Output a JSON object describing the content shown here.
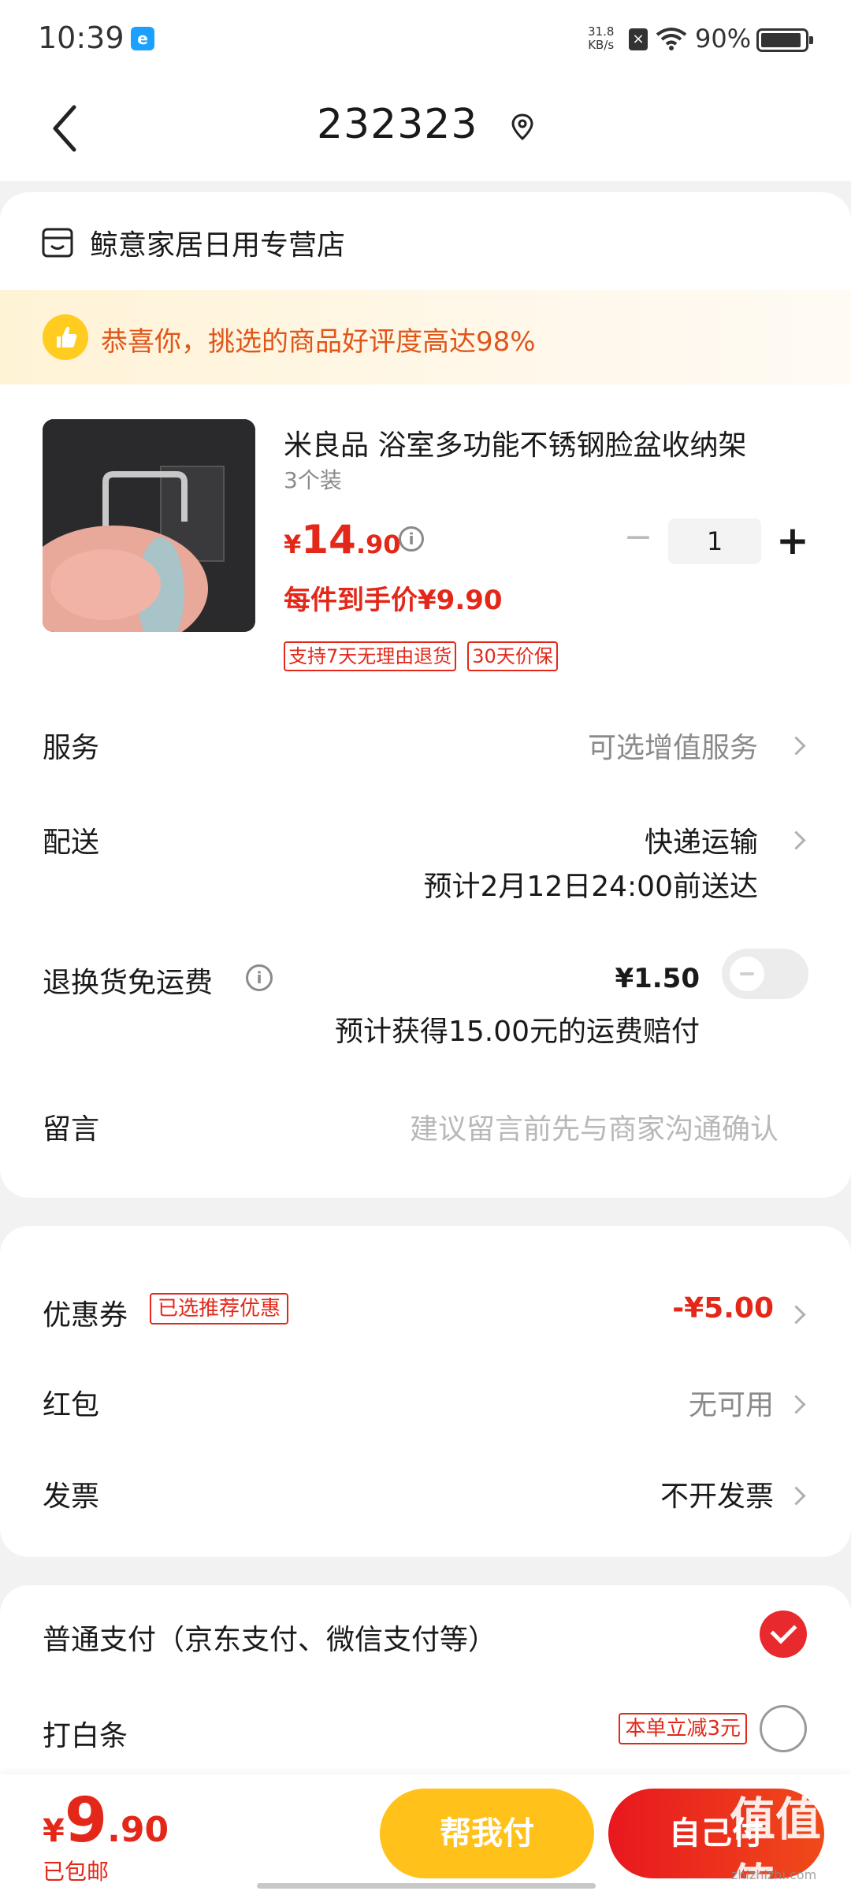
{
  "status_bar": {
    "time": "10:39",
    "net_speed": "31.8",
    "net_unit": "KB/s",
    "battery": "90%",
    "battery_level": 0.9
  },
  "header": {
    "title": "232323"
  },
  "store": {
    "name": "鲸意家居日用专营店"
  },
  "banner": {
    "text": "恭喜你，挑选的商品好评度高达98%"
  },
  "product": {
    "name": "米良品 浴室多功能不锈钢脸盆收纳架",
    "spec": "3个装",
    "price_currency": "¥",
    "price_int": "14",
    "price_dec": ".90",
    "quantity": "1",
    "unit_price": "每件到手价¥9.90",
    "tags": [
      "支持7天无理由退货",
      "30天价保"
    ]
  },
  "rows": {
    "service_label": "服务",
    "service_value": "可选增值服务",
    "delivery_label": "配送",
    "delivery_value": "快递运输",
    "delivery_eta": "预计2月12日24:00前送达",
    "return_label": "退换货免运费",
    "return_price": "¥1.50",
    "return_note": "预计获得15.00元的运费赔付",
    "message_label": "留言",
    "message_placeholder": "建议留言前先与商家沟通确认"
  },
  "discounts": {
    "coupon_label": "优惠券",
    "coupon_tag": "已选推荐优惠",
    "coupon_value": "-¥5.00",
    "redpacket_label": "红包",
    "redpacket_value": "无可用",
    "invoice_label": "发票",
    "invoice_value": "不开发票"
  },
  "payment": {
    "normal_label": "普通支付（京东支付、微信支付等）",
    "baitiao_label": "打白条",
    "baitiao_tag": "本单立减3元"
  },
  "bottom": {
    "total_currency": "¥",
    "total_int": "9",
    "total_dec": ".90",
    "shipping": "已包邮",
    "help_pay": "帮我付",
    "self_pay": "自己付",
    "watermark": "值值值",
    "watermark_site": "zhizhizhi.com"
  },
  "colors": {
    "accent_red": "#e3281a",
    "pay_yellow": "#ffc11a",
    "banner_text": "#e0561a"
  }
}
